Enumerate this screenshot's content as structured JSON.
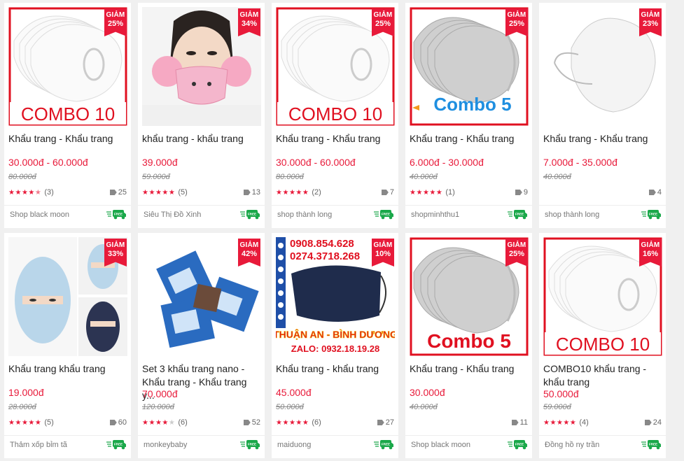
{
  "badge_label": "GIẢM",
  "colors": {
    "accent": "#e81a3a",
    "free_ship": "#1aa84a"
  },
  "products": [
    {
      "title": "Khẩu trang - Khẩu trang",
      "price": "30.000đ - 60.000đ",
      "old_price": "80.000đ",
      "stars": 4.5,
      "star_text": "★★★★★",
      "rating_count": "(3)",
      "views": "25",
      "shop": "Shop black moon",
      "discount": "25%",
      "image_caption": "COMBO 10",
      "image_kind": "white-mask-stack"
    },
    {
      "title": "khẩu trang - khẩu trang",
      "price": "39.000đ",
      "old_price": "59.000đ",
      "stars": 5,
      "star_text": "★★★★★",
      "rating_count": "(5)",
      "views": "13",
      "shop": "Siêu Thị Đồ Xinh",
      "discount": "34%",
      "image_caption": "",
      "image_kind": "pink-mask-girl"
    },
    {
      "title": "Khẩu trang - Khẩu trang",
      "price": "30.000đ - 60.000đ",
      "old_price": "80.000đ",
      "stars": 5,
      "star_text": "★★★★★",
      "rating_count": "(2)",
      "views": "7",
      "shop": "shop thành long",
      "discount": "25%",
      "image_caption": "COMBO 10",
      "image_kind": "white-mask-stack"
    },
    {
      "title": "Khẩu trang - Khẩu trang",
      "price": "6.000đ - 30.000đ",
      "old_price": "40.000đ",
      "stars": 5,
      "star_text": "★★★★★",
      "rating_count": "(1)",
      "views": "9",
      "shop": "shopminhthu1",
      "discount": "25%",
      "image_caption": "Combo 5",
      "image_kind": "grey-mask-stack-blue"
    },
    {
      "title": "Khẩu trang - Khẩu trang",
      "price": "7.000đ - 35.000đ",
      "old_price": "40.000đ",
      "stars": 0,
      "star_text": "",
      "rating_count": "",
      "views": "4",
      "shop": "shop thành long",
      "discount": "23%",
      "image_caption": "",
      "image_kind": "white-mask-single"
    },
    {
      "title": "Khẩu trang khẩu trang",
      "price": "19.000đ",
      "old_price": "28.000đ",
      "stars": 5,
      "star_text": "★★★★★",
      "rating_count": "(5)",
      "views": "60",
      "shop": "Thảm xốp bỉm tã",
      "discount": "33%",
      "image_caption": "",
      "image_kind": "face-cover"
    },
    {
      "title": "Set 3 khẩu trang nano - Khẩu trang - Khẩu trang y...",
      "price": "70.000đ",
      "old_price": "120.000đ",
      "stars": 4,
      "star_text": "★★★★★",
      "rating_count": "(6)",
      "views": "52",
      "shop": "monkeybaby",
      "discount": "42%",
      "image_caption": "",
      "image_kind": "nano-packs"
    },
    {
      "title": "Khẩu trang - khẩu trang",
      "price": "45.000đ",
      "old_price": "50.000đ",
      "stars": 5,
      "star_text": "★★★★★",
      "rating_count": "(6)",
      "views": "27",
      "shop": "maiduong",
      "discount": "10%",
      "image_caption": "THUẬN AN - BÌNH DƯƠNG",
      "image_phone1": "0908.854.628",
      "image_phone2": "0274.3718.268",
      "image_zalo": "ZALO: 0932.18.19.28",
      "image_kind": "navy-mask-ad"
    },
    {
      "title": "Khẩu trang - Khẩu trang",
      "price": "30.000đ",
      "old_price": "40.000đ",
      "stars": 0,
      "star_text": "",
      "rating_count": "",
      "views": "11",
      "shop": "Shop black moon",
      "discount": "25%",
      "image_caption": "Combo 5",
      "image_kind": "grey-mask-stack"
    },
    {
      "title": "COMBO10 khẩu trang - khẩu trang",
      "price": "50.000đ",
      "old_price": "59.000đ",
      "stars": 5,
      "star_text": "★★★★★",
      "rating_count": "(4)",
      "views": "24",
      "shop": "Đồng hồ ny trần",
      "discount": "16%",
      "image_caption": "COMBO 10",
      "image_kind": "white-mask-stack"
    }
  ],
  "free_ship_label": "FREE"
}
